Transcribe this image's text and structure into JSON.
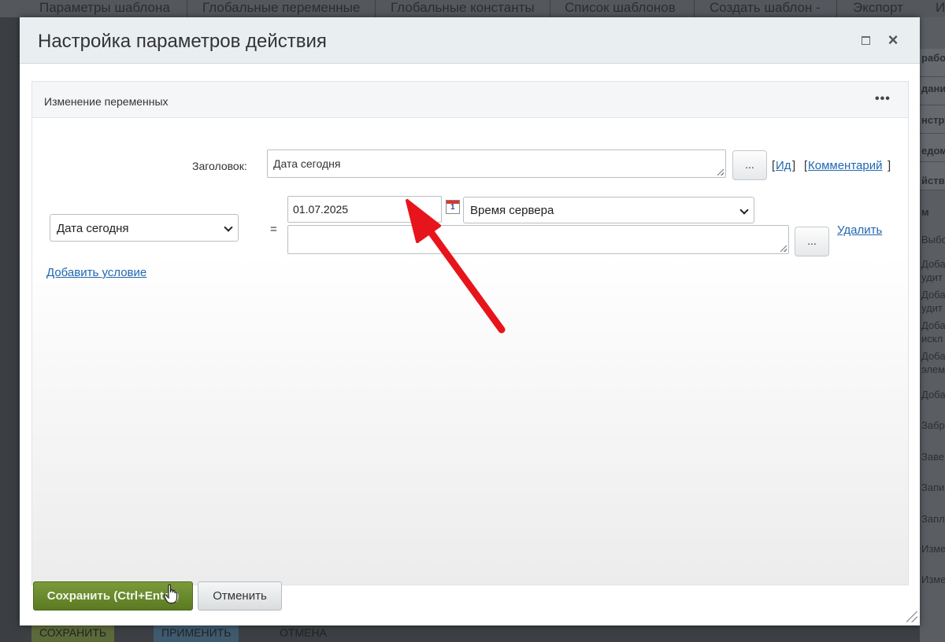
{
  "background": {
    "top_tabs": [
      "Параметры шаблона",
      "Глобальные переменные",
      "Глобальные константы",
      "Список шаблонов",
      "Создать шаблон -",
      "Экспорт",
      "И"
    ],
    "right_panel_items": [
      "рабо",
      "дания",
      "нстру",
      "едом",
      "йстви",
      "м",
      "Выбор",
      "Добав",
      "удит",
      "Добав",
      "удит",
      "Добав",
      "искл",
      "Добав",
      "элеме",
      "Добав",
      "Забро",
      "Завер",
      "Запис",
      "Запла",
      "Измен",
      "Измен"
    ],
    "bottom_buttons": [
      "СОХРАНИТЬ",
      "ПРИМЕНИТЬ",
      "ОТМЕНА"
    ]
  },
  "dialog": {
    "title": "Настройка параметров действия",
    "panel_title": "Изменение переменных",
    "panel_menu": "•••",
    "title_label": "Заголовок:",
    "title_value": "Дата сегодня",
    "dots_label": "...",
    "bracket_open": "[",
    "bracket_close": "]",
    "id_link": "Ид",
    "comment_link": "Комментарий",
    "variable_select": "Дата сегодня",
    "equals": "=",
    "date_value": "01.07.2025",
    "calendar_day": "1",
    "timezone_select": "Время сервера",
    "expression_value": "",
    "delete_link": "Удалить",
    "add_condition_link": "Добавить условие",
    "save_button": "Сохранить (Ctrl+Enter)",
    "cancel_button": "Отменить"
  },
  "colors": {
    "save_button": "#6b8a2e",
    "link": "#2067b0",
    "annotation_arrow": "#e8141b"
  }
}
